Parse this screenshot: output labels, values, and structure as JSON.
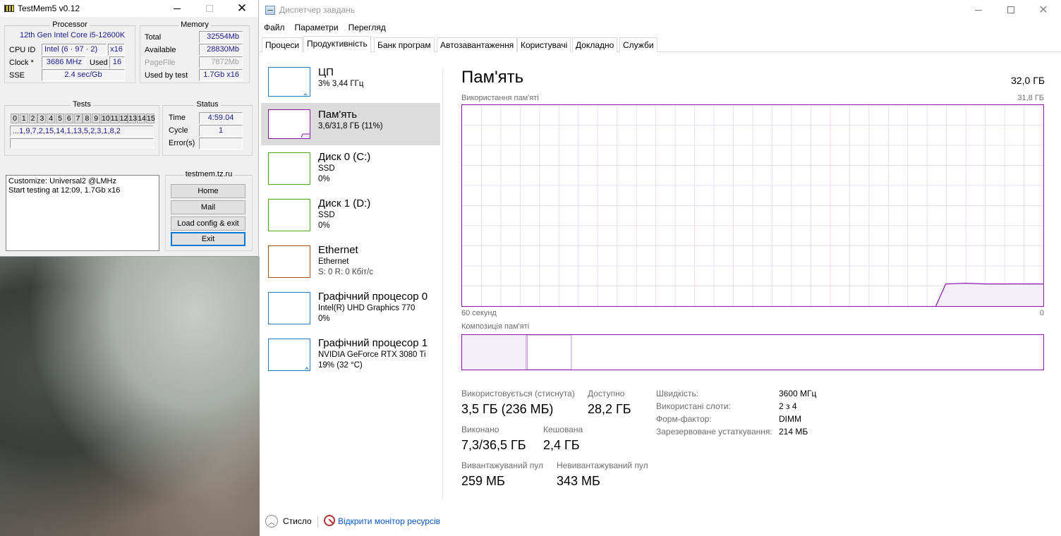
{
  "testmem": {
    "title": "TestMem5 v0.12",
    "processor": {
      "group_title": "Processor",
      "name": "12th Gen Intel Core i5-12600K",
      "cpu_id_label": "CPU ID",
      "cpu_id_value": "Intel  (6 · 97 · 2)",
      "threads": "x16",
      "clock_label": "Clock *",
      "clock_value": "3686 MHz",
      "used_label": "Used",
      "used_value": "16",
      "sse_label": "SSE",
      "sse_value": "2.4 sec/Gb"
    },
    "memory": {
      "group_title": "Memory",
      "total_label": "Total",
      "total_value": "32554Mb",
      "available_label": "Available",
      "available_value": "28830Mb",
      "pagefile_label": "PageFile",
      "pagefile_value": "7872Mb",
      "used_by_test_label": "Used by test",
      "used_by_test_value": "1.7Gb x16"
    },
    "tests": {
      "group_title": "Tests",
      "numbers": [
        "0",
        "1",
        "2",
        "3",
        "4",
        "5",
        "6",
        "7",
        "8",
        "9",
        "10",
        "11",
        "12",
        "13",
        "14",
        "15"
      ],
      "sequence": "...1,9,7,2,15,14,1,13,5,2,3,1,8,2"
    },
    "status": {
      "group_title": "Status",
      "time_label": "Time",
      "time_value": "4:59.04",
      "cycle_label": "Cycle",
      "cycle_value": "1",
      "errors_label": "Error(s)",
      "errors_value": ""
    },
    "log": {
      "line1": "Customize: Universal2 @LMHz",
      "line2": "Start testing at 12:09, 1.7Gb x16"
    },
    "site": {
      "group_title": "testmem.tz.ru",
      "home_label": "Home",
      "mail_label": "Mail",
      "load_label": "Load config & exit",
      "exit_label": "Exit"
    }
  },
  "taskmgr": {
    "title": "Диспетчер завдань",
    "menu": [
      "Файл",
      "Параметри",
      "Перегляд"
    ],
    "tabs": [
      "Процеси",
      "Продуктивність",
      "Банк програм",
      "Автозавантаження",
      "Користувачі",
      "Докладно",
      "Служби"
    ],
    "active_tab": "Продуктивність",
    "sidebar": [
      {
        "title": "ЦП",
        "line1": "3% 3,44 ГГц",
        "line2": "",
        "color": "#1b7ac2"
      },
      {
        "title": "Пам'ять",
        "line1": "3,6/31,8 ГБ (11%)",
        "line2": "",
        "color": "#8b12ae"
      },
      {
        "title": "Диск 0 (C:)",
        "line1": "SSD",
        "line2": "0%",
        "color": "#4da60c"
      },
      {
        "title": "Диск 1 (D:)",
        "line1": "SSD",
        "line2": "0%",
        "color": "#4da60c"
      },
      {
        "title": "Ethernet",
        "line1": "Ethernet",
        "line2": "S: 0 R: 0 Кбіт/с",
        "color": "#a74f01"
      },
      {
        "title": "Графічний процесор 0",
        "line1": "Intel(R) UHD Graphics 770",
        "line2": "0%",
        "color": "#1b7ac2"
      },
      {
        "title": "Графічний процесор 1",
        "line1": "NVIDIA GeForce RTX 3080 Ti",
        "line2": "19%  (32 °C)",
        "color": "#1b7ac2"
      }
    ],
    "main": {
      "heading": "Пам'ять",
      "total": "32,0 ГБ",
      "usage_label": "Використання пам'яті",
      "usage_max": "31,8 ГБ",
      "axis_left": "60 секунд",
      "axis_right": "0",
      "composition_label": "Композиція пам'яті",
      "usage_fraction": 0.11,
      "composition": {
        "in_use_gb": 3.5,
        "modified_gb": 0.07,
        "standby_gb": 2.4,
        "total_gb": 31.8
      },
      "stats": {
        "in_use_label": "Використовується (стиснута)",
        "in_use_value": "3,5 ГБ (236 МБ)",
        "available_label": "Доступно",
        "available_value": "28,2 ГБ",
        "committed_label": "Виконано",
        "committed_value": "7,3/36,5 ГБ",
        "cached_label": "Кешована",
        "cached_value": "2,4 ГБ",
        "paged_label": "Вивантажуваний пул",
        "paged_value": "259 МБ",
        "nonpaged_label": "Невивантажуваний пул",
        "nonpaged_value": "343 МБ"
      },
      "details": {
        "speed_label": "Швидкість:",
        "speed_value": "3600 МГц",
        "slots_label": "Використані слоти:",
        "slots_value": "2 з 4",
        "form_label": "Форм-фактор:",
        "form_value": "DIMM",
        "reserved_label": "Зарезервоване устаткування:",
        "reserved_value": "214 МБ"
      }
    },
    "footer": {
      "less_label": "Стисло",
      "monitor_label": "Відкрити монітор ресурсів"
    },
    "colors": {
      "memory_accent": "#8b12ae"
    }
  }
}
